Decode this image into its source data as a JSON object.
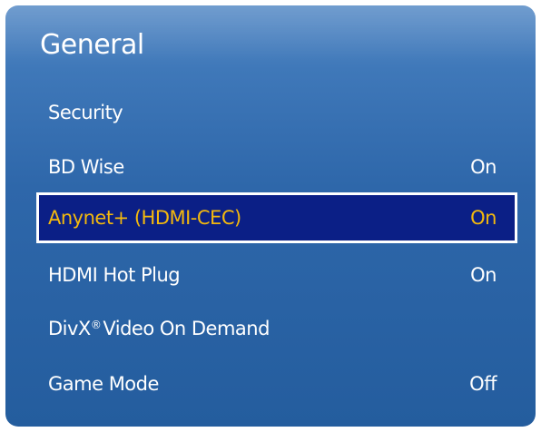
{
  "menu": {
    "title": "General",
    "items": [
      {
        "label": "Security",
        "value": ""
      },
      {
        "label": "BD Wise",
        "value": "On"
      },
      {
        "label": "Anynet+ (HDMI-CEC)",
        "value": "On"
      },
      {
        "label": "HDMI Hot Plug",
        "value": "On"
      },
      {
        "label_prefix": "DivX",
        "label_mark": "®",
        "label_suffix": "Video On Demand",
        "value": ""
      },
      {
        "label": "Game Mode",
        "value": "Off"
      }
    ],
    "selected_index": 2
  },
  "colors": {
    "panel_top": "#5d8fc8",
    "panel_bottom": "#245d9e",
    "highlight_bg": "#0b1f86",
    "highlight_text": "#f4b90d",
    "text": "#ffffff"
  }
}
